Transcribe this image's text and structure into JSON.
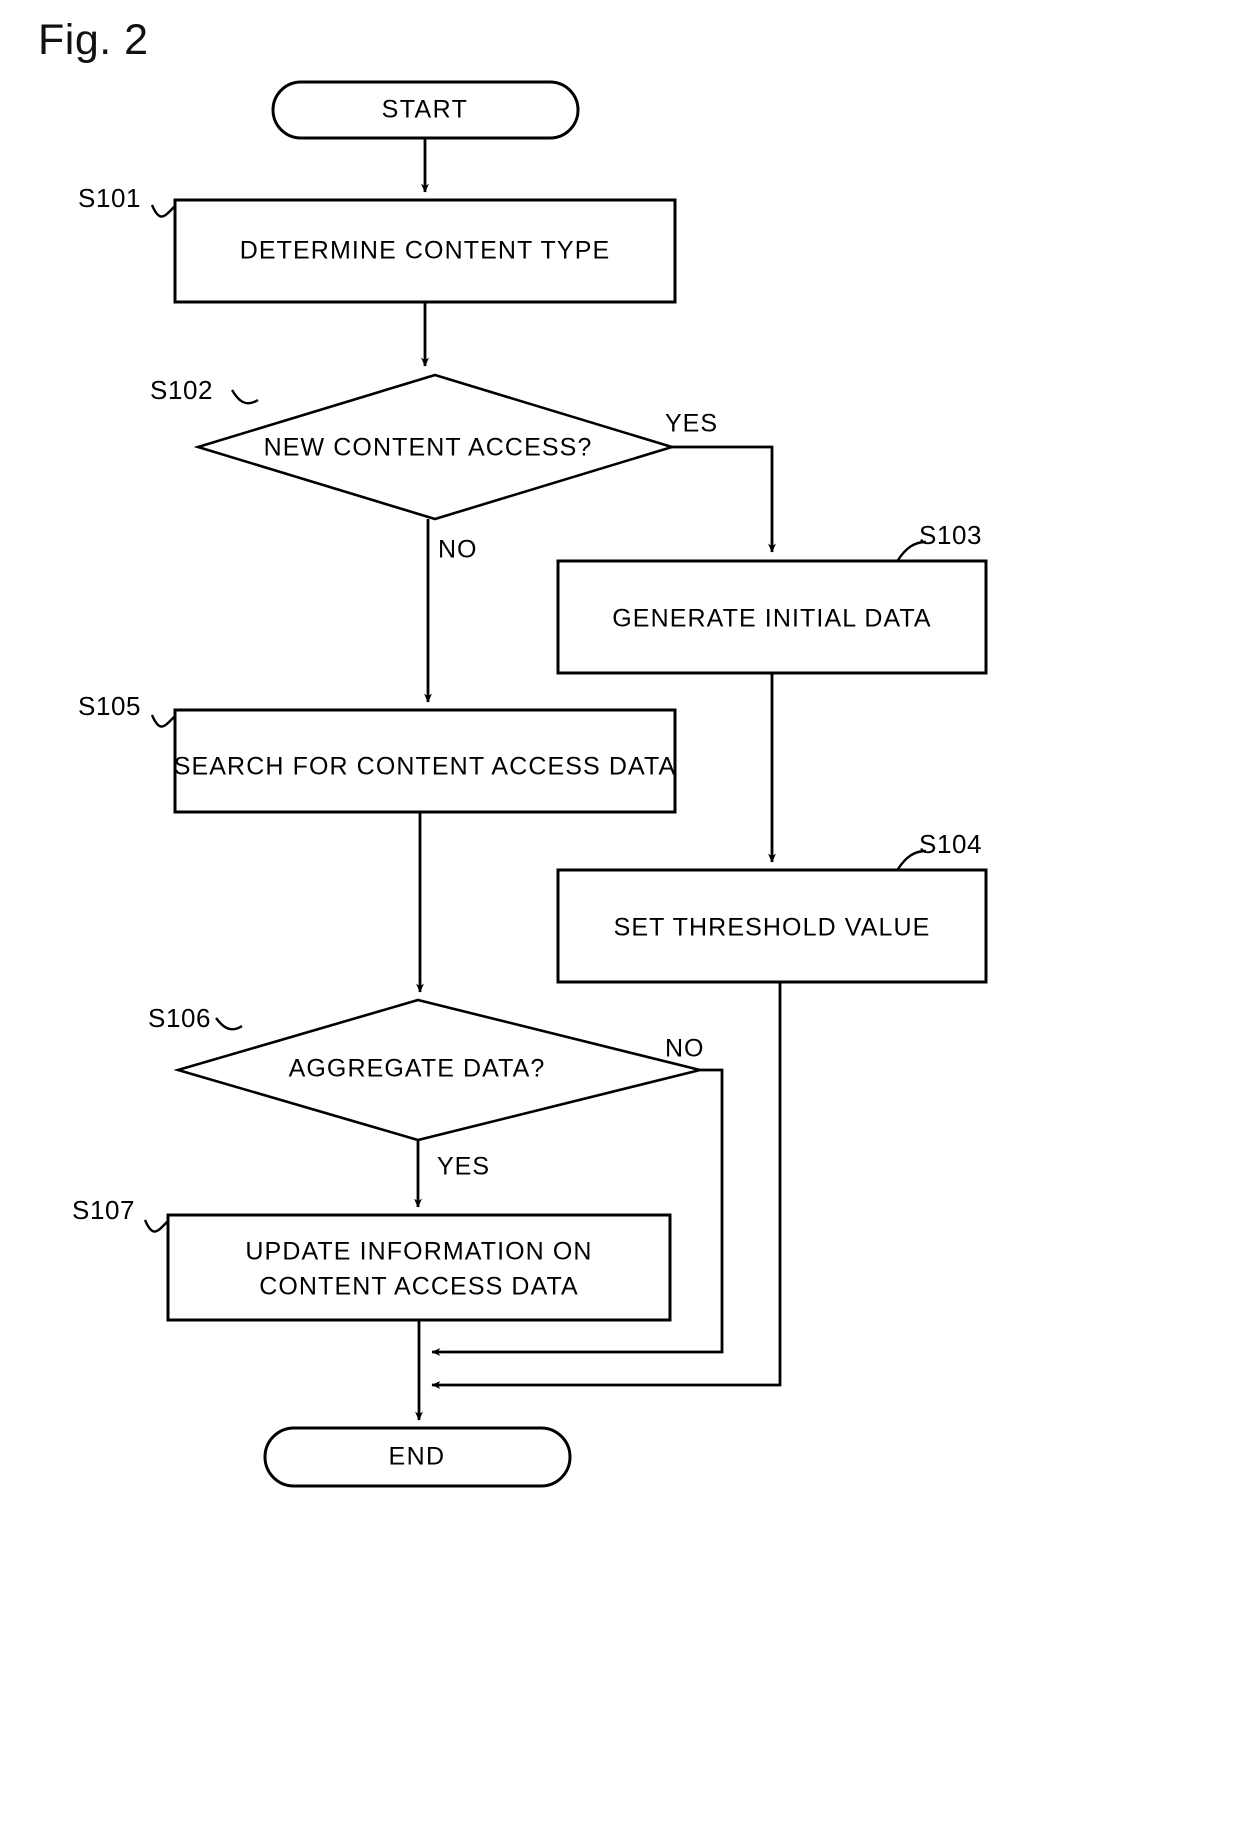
{
  "figure": {
    "label": "Fig. 2"
  },
  "diagram": {
    "type": "flowchart",
    "terminators": {
      "start": "START",
      "end": "END"
    },
    "steps": [
      {
        "id": "S101",
        "text": "DETERMINE CONTENT TYPE",
        "shape": "process"
      },
      {
        "id": "S102",
        "text": "NEW CONTENT ACCESS?",
        "shape": "decision"
      },
      {
        "id": "S103",
        "text": "GENERATE INITIAL DATA",
        "shape": "process"
      },
      {
        "id": "S104",
        "text": "SET THRESHOLD VALUE",
        "shape": "process"
      },
      {
        "id": "S105",
        "text": "SEARCH FOR CONTENT ACCESS DATA",
        "shape": "process"
      },
      {
        "id": "S106",
        "text": "AGGREGATE DATA?",
        "shape": "decision"
      },
      {
        "id": "S107",
        "text": "UPDATE INFORMATION ON CONTENT ACCESS DATA",
        "text_line1": "UPDATE INFORMATION ON",
        "text_line2": "CONTENT ACCESS DATA",
        "shape": "process"
      }
    ],
    "branch_labels": {
      "s102_yes": "YES",
      "s102_no": "NO",
      "s106_no": "NO",
      "s106_yes": "YES"
    },
    "colors": {
      "stroke": "#000000",
      "fill": "#ffffff",
      "text": "#000000"
    }
  }
}
